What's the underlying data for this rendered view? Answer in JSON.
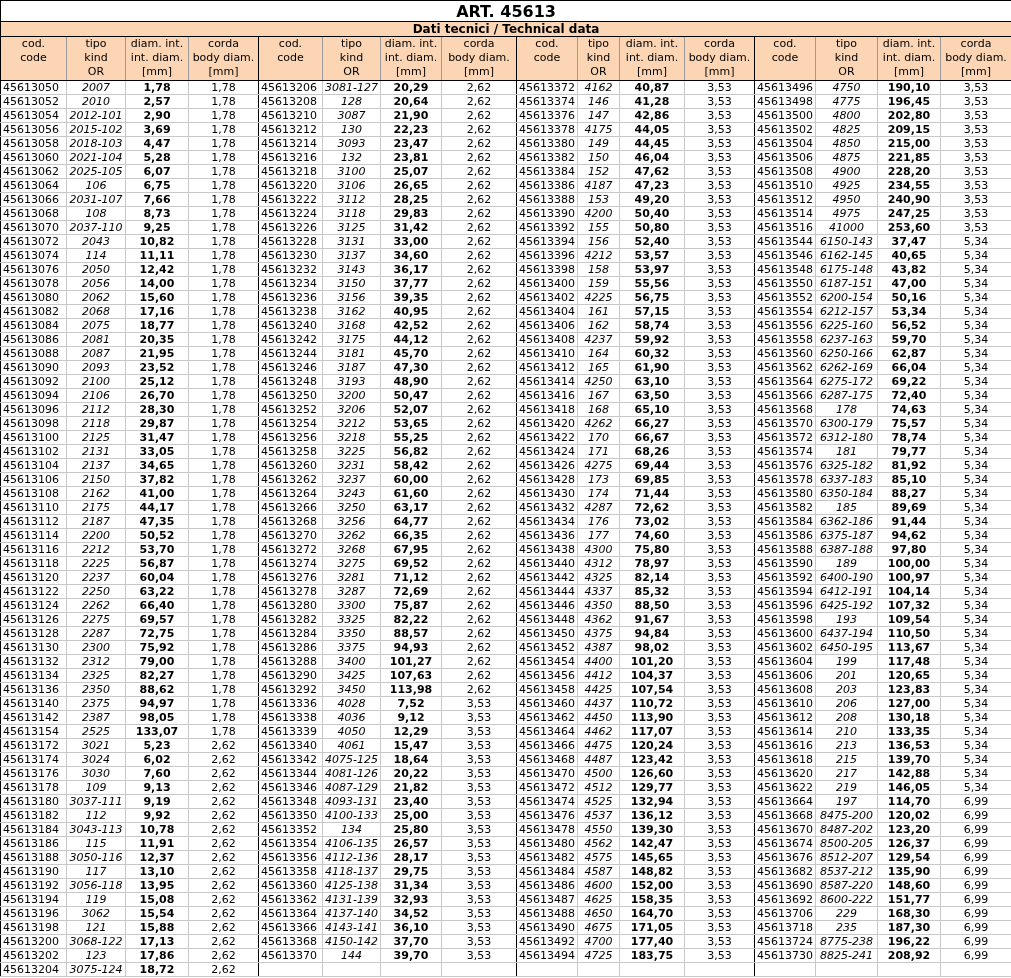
{
  "title": "ART. 45613",
  "subtitle": "Dati tecnici / Technical data",
  "groups": [
    {
      "columns": [
        "cod.\ncode",
        "tipo\nkind\nOR",
        "diam. int.\nint. diam.\n[mm]",
        "corda\nbody diam.\n[mm]"
      ],
      "rows": [
        {
          "code": "45613050",
          "kind": "2007",
          "int_diam": "1,78",
          "body_diam": "1,78"
        },
        {
          "code": "45613052",
          "kind": "2010",
          "int_diam": "2,57",
          "body_diam": "1,78"
        },
        {
          "code": "45613054",
          "kind": "2012-101",
          "int_diam": "2,90",
          "body_diam": "1,78"
        },
        {
          "code": "45613056",
          "kind": "2015-102",
          "int_diam": "3,69",
          "body_diam": "1,78"
        },
        {
          "code": "45613058",
          "kind": "2018-103",
          "int_diam": "4,47",
          "body_diam": "1,78"
        },
        {
          "code": "45613060",
          "kind": "2021-104",
          "int_diam": "5,28",
          "body_diam": "1,78"
        },
        {
          "code": "45613062",
          "kind": "2025-105",
          "int_diam": "6,07",
          "body_diam": "1,78"
        },
        {
          "code": "45613064",
          "kind": "106",
          "int_diam": "6,75",
          "body_diam": "1,78"
        },
        {
          "code": "45613066",
          "kind": "2031-107",
          "int_diam": "7,66",
          "body_diam": "1,78"
        },
        {
          "code": "45613068",
          "kind": "108",
          "int_diam": "8,73",
          "body_diam": "1,78"
        },
        {
          "code": "45613070",
          "kind": "2037-110",
          "int_diam": "9,25",
          "body_diam": "1,78"
        },
        {
          "code": "45613072",
          "kind": "2043",
          "int_diam": "10,82",
          "body_diam": "1,78"
        },
        {
          "code": "45613074",
          "kind": "114",
          "int_diam": "11,11",
          "body_diam": "1,78"
        },
        {
          "code": "45613076",
          "kind": "2050",
          "int_diam": "12,42",
          "body_diam": "1,78"
        },
        {
          "code": "45613078",
          "kind": "2056",
          "int_diam": "14,00",
          "body_diam": "1,78"
        },
        {
          "code": "45613080",
          "kind": "2062",
          "int_diam": "15,60",
          "body_diam": "1,78"
        },
        {
          "code": "45613082",
          "kind": "2068",
          "int_diam": "17,16",
          "body_diam": "1,78"
        },
        {
          "code": "45613084",
          "kind": "2075",
          "int_diam": "18,77",
          "body_diam": "1,78"
        },
        {
          "code": "45613086",
          "kind": "2081",
          "int_diam": "20,35",
          "body_diam": "1,78"
        },
        {
          "code": "45613088",
          "kind": "2087",
          "int_diam": "21,95",
          "body_diam": "1,78"
        },
        {
          "code": "45613090",
          "kind": "2093",
          "int_diam": "23,52",
          "body_diam": "1,78"
        },
        {
          "code": "45613092",
          "kind": "2100",
          "int_diam": "25,12",
          "body_diam": "1,78"
        },
        {
          "code": "45613094",
          "kind": "2106",
          "int_diam": "26,70",
          "body_diam": "1,78"
        },
        {
          "code": "45613096",
          "kind": "2112",
          "int_diam": "28,30",
          "body_diam": "1,78"
        },
        {
          "code": "45613098",
          "kind": "2118",
          "int_diam": "29,87",
          "body_diam": "1,78"
        },
        {
          "code": "45613100",
          "kind": "2125",
          "int_diam": "31,47",
          "body_diam": "1,78"
        },
        {
          "code": "45613102",
          "kind": "2131",
          "int_diam": "33,05",
          "body_diam": "1,78"
        },
        {
          "code": "45613104",
          "kind": "2137",
          "int_diam": "34,65",
          "body_diam": "1,78"
        },
        {
          "code": "45613106",
          "kind": "2150",
          "int_diam": "37,82",
          "body_diam": "1,78"
        },
        {
          "code": "45613108",
          "kind": "2162",
          "int_diam": "41,00",
          "body_diam": "1,78"
        },
        {
          "code": "45613110",
          "kind": "2175",
          "int_diam": "44,17",
          "body_diam": "1,78"
        },
        {
          "code": "45613112",
          "kind": "2187",
          "int_diam": "47,35",
          "body_diam": "1,78"
        },
        {
          "code": "45613114",
          "kind": "2200",
          "int_diam": "50,52",
          "body_diam": "1,78"
        },
        {
          "code": "45613116",
          "kind": "2212",
          "int_diam": "53,70",
          "body_diam": "1,78"
        },
        {
          "code": "45613118",
          "kind": "2225",
          "int_diam": "56,87",
          "body_diam": "1,78"
        },
        {
          "code": "45613120",
          "kind": "2237",
          "int_diam": "60,04",
          "body_diam": "1,78"
        },
        {
          "code": "45613122",
          "kind": "2250",
          "int_diam": "63,22",
          "body_diam": "1,78"
        },
        {
          "code": "45613124",
          "kind": "2262",
          "int_diam": "66,40",
          "body_diam": "1,78"
        },
        {
          "code": "45613126",
          "kind": "2275",
          "int_diam": "69,57",
          "body_diam": "1,78"
        },
        {
          "code": "45613128",
          "kind": "2287",
          "int_diam": "72,75",
          "body_diam": "1,78"
        },
        {
          "code": "45613130",
          "kind": "2300",
          "int_diam": "75,92",
          "body_diam": "1,78"
        },
        {
          "code": "45613132",
          "kind": "2312",
          "int_diam": "79,00",
          "body_diam": "1,78"
        },
        {
          "code": "45613134",
          "kind": "2325",
          "int_diam": "82,27",
          "body_diam": "1,78"
        },
        {
          "code": "45613136",
          "kind": "2350",
          "int_diam": "88,62",
          "body_diam": "1,78"
        },
        {
          "code": "45613140",
          "kind": "2375",
          "int_diam": "94,97",
          "body_diam": "1,78"
        },
        {
          "code": "45613142",
          "kind": "2387",
          "int_diam": "98,05",
          "body_diam": "1,78"
        },
        {
          "code": "45613154",
          "kind": "2525",
          "int_diam": "133,07",
          "body_diam": "1,78"
        },
        {
          "code": "45613172",
          "kind": "3021",
          "int_diam": "5,23",
          "body_diam": "2,62"
        },
        {
          "code": "45613174",
          "kind": "3024",
          "int_diam": "6,02",
          "body_diam": "2,62"
        },
        {
          "code": "45613176",
          "kind": "3030",
          "int_diam": "7,60",
          "body_diam": "2,62"
        },
        {
          "code": "45613178",
          "kind": "109",
          "int_diam": "9,13",
          "body_diam": "2,62"
        },
        {
          "code": "45613180",
          "kind": "3037-111",
          "int_diam": "9,19",
          "body_diam": "2,62"
        },
        {
          "code": "45613182",
          "kind": "112",
          "int_diam": "9,92",
          "body_diam": "2,62"
        },
        {
          "code": "45613184",
          "kind": "3043-113",
          "int_diam": "10,78",
          "body_diam": "2,62"
        },
        {
          "code": "45613186",
          "kind": "115",
          "int_diam": "11,91",
          "body_diam": "2,62"
        },
        {
          "code": "45613188",
          "kind": "3050-116",
          "int_diam": "12,37",
          "body_diam": "2,62"
        },
        {
          "code": "45613190",
          "kind": "117",
          "int_diam": "13,10",
          "body_diam": "2,62"
        },
        {
          "code": "45613192",
          "kind": "3056-118",
          "int_diam": "13,95",
          "body_diam": "2,62"
        },
        {
          "code": "45613194",
          "kind": "119",
          "int_diam": "15,08",
          "body_diam": "2,62"
        },
        {
          "code": "45613196",
          "kind": "3062",
          "int_diam": "15,54",
          "body_diam": "2,62"
        },
        {
          "code": "45613198",
          "kind": "121",
          "int_diam": "15,88",
          "body_diam": "2,62"
        },
        {
          "code": "45613200",
          "kind": "3068-122",
          "int_diam": "17,13",
          "body_diam": "2,62"
        },
        {
          "code": "45613202",
          "kind": "123",
          "int_diam": "17,86",
          "body_diam": "2,62"
        },
        {
          "code": "45613204",
          "kind": "3075-124",
          "int_diam": "18,72",
          "body_diam": "2,62"
        }
      ]
    },
    {
      "columns": [
        "cod.\ncode",
        "tipo\nkind\nOR",
        "diam. int.\nint. diam.\n[mm]",
        "corda\nbody diam.\n[mm]"
      ],
      "rows": [
        {
          "code": "45613206",
          "kind": "3081-127",
          "int_diam": "20,29",
          "body_diam": "2,62"
        },
        {
          "code": "45613208",
          "kind": "128",
          "int_diam": "20,64",
          "body_diam": "2,62"
        },
        {
          "code": "45613210",
          "kind": "3087",
          "int_diam": "21,90",
          "body_diam": "2,62"
        },
        {
          "code": "45613212",
          "kind": "130",
          "int_diam": "22,23",
          "body_diam": "2,62"
        },
        {
          "code": "45613214",
          "kind": "3093",
          "int_diam": "23,47",
          "body_diam": "2,62"
        },
        {
          "code": "45613216",
          "kind": "132",
          "int_diam": "23,81",
          "body_diam": "2,62"
        },
        {
          "code": "45613218",
          "kind": "3100",
          "int_diam": "25,07",
          "body_diam": "2,62"
        },
        {
          "code": "45613220",
          "kind": "3106",
          "int_diam": "26,65",
          "body_diam": "2,62"
        },
        {
          "code": "45613222",
          "kind": "3112",
          "int_diam": "28,25",
          "body_diam": "2,62"
        },
        {
          "code": "45613224",
          "kind": "3118",
          "int_diam": "29,83",
          "body_diam": "2,62"
        },
        {
          "code": "45613226",
          "kind": "3125",
          "int_diam": "31,42",
          "body_diam": "2,62"
        },
        {
          "code": "45613228",
          "kind": "3131",
          "int_diam": "33,00",
          "body_diam": "2,62"
        },
        {
          "code": "45613230",
          "kind": "3137",
          "int_diam": "34,60",
          "body_diam": "2,62"
        },
        {
          "code": "45613232",
          "kind": "3143",
          "int_diam": "36,17",
          "body_diam": "2,62"
        },
        {
          "code": "45613234",
          "kind": "3150",
          "int_diam": "37,77",
          "body_diam": "2,62"
        },
        {
          "code": "45613236",
          "kind": "3156",
          "int_diam": "39,35",
          "body_diam": "2,62"
        },
        {
          "code": "45613238",
          "kind": "3162",
          "int_diam": "40,95",
          "body_diam": "2,62"
        },
        {
          "code": "45613240",
          "kind": "3168",
          "int_diam": "42,52",
          "body_diam": "2,62"
        },
        {
          "code": "45613242",
          "kind": "3175",
          "int_diam": "44,12",
          "body_diam": "2,62"
        },
        {
          "code": "45613244",
          "kind": "3181",
          "int_diam": "45,70",
          "body_diam": "2,62"
        },
        {
          "code": "45613246",
          "kind": "3187",
          "int_diam": "47,30",
          "body_diam": "2,62"
        },
        {
          "code": "45613248",
          "kind": "3193",
          "int_diam": "48,90",
          "body_diam": "2,62"
        },
        {
          "code": "45613250",
          "kind": "3200",
          "int_diam": "50,47",
          "body_diam": "2,62"
        },
        {
          "code": "45613252",
          "kind": "3206",
          "int_diam": "52,07",
          "body_diam": "2,62"
        },
        {
          "code": "45613254",
          "kind": "3212",
          "int_diam": "53,65",
          "body_diam": "2,62"
        },
        {
          "code": "45613256",
          "kind": "3218",
          "int_diam": "55,25",
          "body_diam": "2,62"
        },
        {
          "code": "45613258",
          "kind": "3225",
          "int_diam": "56,82",
          "body_diam": "2,62"
        },
        {
          "code": "45613260",
          "kind": "3231",
          "int_diam": "58,42",
          "body_diam": "2,62"
        },
        {
          "code": "45613262",
          "kind": "3237",
          "int_diam": "60,00",
          "body_diam": "2,62"
        },
        {
          "code": "45613264",
          "kind": "3243",
          "int_diam": "61,60",
          "body_diam": "2,62"
        },
        {
          "code": "45613266",
          "kind": "3250",
          "int_diam": "63,17",
          "body_diam": "2,62"
        },
        {
          "code": "45613268",
          "kind": "3256",
          "int_diam": "64,77",
          "body_diam": "2,62"
        },
        {
          "code": "45613270",
          "kind": "3262",
          "int_diam": "66,35",
          "body_diam": "2,62"
        },
        {
          "code": "45613272",
          "kind": "3268",
          "int_diam": "67,95",
          "body_diam": "2,62"
        },
        {
          "code": "45613274",
          "kind": "3275",
          "int_diam": "69,52",
          "body_diam": "2,62"
        },
        {
          "code": "45613276",
          "kind": "3281",
          "int_diam": "71,12",
          "body_diam": "2,62"
        },
        {
          "code": "45613278",
          "kind": "3287",
          "int_diam": "72,69",
          "body_diam": "2,62"
        },
        {
          "code": "45613280",
          "kind": "3300",
          "int_diam": "75,87",
          "body_diam": "2,62"
        },
        {
          "code": "45613282",
          "kind": "3325",
          "int_diam": "82,22",
          "body_diam": "2,62"
        },
        {
          "code": "45613284",
          "kind": "3350",
          "int_diam": "88,57",
          "body_diam": "2,62"
        },
        {
          "code": "45613286",
          "kind": "3375",
          "int_diam": "94,93",
          "body_diam": "2,62"
        },
        {
          "code": "45613288",
          "kind": "3400",
          "int_diam": "101,27",
          "body_diam": "2,62"
        },
        {
          "code": "45613290",
          "kind": "3425",
          "int_diam": "107,63",
          "body_diam": "2,62"
        },
        {
          "code": "45613292",
          "kind": "3450",
          "int_diam": "113,98",
          "body_diam": "2,62"
        },
        {
          "code": "45613336",
          "kind": "4028",
          "int_diam": "7,52",
          "body_diam": "3,53"
        },
        {
          "code": "45613338",
          "kind": "4036",
          "int_diam": "9,12",
          "body_diam": "3,53"
        },
        {
          "code": "45613339",
          "kind": "4050",
          "int_diam": "12,29",
          "body_diam": "3,53"
        },
        {
          "code": "45613340",
          "kind": "4061",
          "int_diam": "15,47",
          "body_diam": "3,53"
        },
        {
          "code": "45613342",
          "kind": "4075-125",
          "int_diam": "18,64",
          "body_diam": "3,53"
        },
        {
          "code": "45613344",
          "kind": "4081-126",
          "int_diam": "20,22",
          "body_diam": "3,53"
        },
        {
          "code": "45613346",
          "kind": "4087-129",
          "int_diam": "21,82",
          "body_diam": "3,53"
        },
        {
          "code": "45613348",
          "kind": "4093-131",
          "int_diam": "23,40",
          "body_diam": "3,53"
        },
        {
          "code": "45613350",
          "kind": "4100-133",
          "int_diam": "25,00",
          "body_diam": "3,53"
        },
        {
          "code": "45613352",
          "kind": "134",
          "int_diam": "25,80",
          "body_diam": "3,53"
        },
        {
          "code": "45613354",
          "kind": "4106-135",
          "int_diam": "26,57",
          "body_diam": "3,53"
        },
        {
          "code": "45613356",
          "kind": "4112-136",
          "int_diam": "28,17",
          "body_diam": "3,53"
        },
        {
          "code": "45613358",
          "kind": "4118-137",
          "int_diam": "29,75",
          "body_diam": "3,53"
        },
        {
          "code": "45613360",
          "kind": "4125-138",
          "int_diam": "31,34",
          "body_diam": "3,53"
        },
        {
          "code": "45613362",
          "kind": "4131-139",
          "int_diam": "32,93",
          "body_diam": "3,53"
        },
        {
          "code": "45613364",
          "kind": "4137-140",
          "int_diam": "34,52",
          "body_diam": "3,53"
        },
        {
          "code": "45613366",
          "kind": "4143-141",
          "int_diam": "36,10",
          "body_diam": "3,53"
        },
        {
          "code": "45613368",
          "kind": "4150-142",
          "int_diam": "37,70",
          "body_diam": "3,53"
        },
        {
          "code": "45613370",
          "kind": "144",
          "int_diam": "39,70",
          "body_diam": "3,53"
        }
      ]
    },
    {
      "columns": [
        "cod.\ncode",
        "tipo\nkind\nOR",
        "diam. int.\nint. diam.\n[mm]",
        "corda\nbody diam.\n[mm]"
      ],
      "rows": [
        {
          "code": "45613372",
          "kind": "4162",
          "int_diam": "40,87",
          "body_diam": "3,53"
        },
        {
          "code": "45613374",
          "kind": "146",
          "int_diam": "41,28",
          "body_diam": "3,53"
        },
        {
          "code": "45613376",
          "kind": "147",
          "int_diam": "42,86",
          "body_diam": "3,53"
        },
        {
          "code": "45613378",
          "kind": "4175",
          "int_diam": "44,05",
          "body_diam": "3,53"
        },
        {
          "code": "45613380",
          "kind": "149",
          "int_diam": "44,45",
          "body_diam": "3,53"
        },
        {
          "code": "45613382",
          "kind": "150",
          "int_diam": "46,04",
          "body_diam": "3,53"
        },
        {
          "code": "45613384",
          "kind": "152",
          "int_diam": "47,62",
          "body_diam": "3,53"
        },
        {
          "code": "45613386",
          "kind": "4187",
          "int_diam": "47,23",
          "body_diam": "3,53"
        },
        {
          "code": "45613388",
          "kind": "153",
          "int_diam": "49,20",
          "body_diam": "3,53"
        },
        {
          "code": "45613390",
          "kind": "4200",
          "int_diam": "50,40",
          "body_diam": "3,53"
        },
        {
          "code": "45613392",
          "kind": "155",
          "int_diam": "50,80",
          "body_diam": "3,53"
        },
        {
          "code": "45613394",
          "kind": "156",
          "int_diam": "52,40",
          "body_diam": "3,53"
        },
        {
          "code": "45613396",
          "kind": "4212",
          "int_diam": "53,57",
          "body_diam": "3,53"
        },
        {
          "code": "45613398",
          "kind": "158",
          "int_diam": "53,97",
          "body_diam": "3,53"
        },
        {
          "code": "45613400",
          "kind": "159",
          "int_diam": "55,56",
          "body_diam": "3,53"
        },
        {
          "code": "45613402",
          "kind": "4225",
          "int_diam": "56,75",
          "body_diam": "3,53"
        },
        {
          "code": "45613404",
          "kind": "161",
          "int_diam": "57,15",
          "body_diam": "3,53"
        },
        {
          "code": "45613406",
          "kind": "162",
          "int_diam": "58,74",
          "body_diam": "3,53"
        },
        {
          "code": "45613408",
          "kind": "4237",
          "int_diam": "59,92",
          "body_diam": "3,53"
        },
        {
          "code": "45613410",
          "kind": "164",
          "int_diam": "60,32",
          "body_diam": "3,53"
        },
        {
          "code": "45613412",
          "kind": "165",
          "int_diam": "61,90",
          "body_diam": "3,53"
        },
        {
          "code": "45613414",
          "kind": "4250",
          "int_diam": "63,10",
          "body_diam": "3,53"
        },
        {
          "code": "45613416",
          "kind": "167",
          "int_diam": "63,50",
          "body_diam": "3,53"
        },
        {
          "code": "45613418",
          "kind": "168",
          "int_diam": "65,10",
          "body_diam": "3,53"
        },
        {
          "code": "45613420",
          "kind": "4262",
          "int_diam": "66,27",
          "body_diam": "3,53"
        },
        {
          "code": "45613422",
          "kind": "170",
          "int_diam": "66,67",
          "body_diam": "3,53"
        },
        {
          "code": "45613424",
          "kind": "171",
          "int_diam": "68,26",
          "body_diam": "3,53"
        },
        {
          "code": "45613426",
          "kind": "4275",
          "int_diam": "69,44",
          "body_diam": "3,53"
        },
        {
          "code": "45613428",
          "kind": "173",
          "int_diam": "69,85",
          "body_diam": "3,53"
        },
        {
          "code": "45613430",
          "kind": "174",
          "int_diam": "71,44",
          "body_diam": "3,53"
        },
        {
          "code": "45613432",
          "kind": "4287",
          "int_diam": "72,62",
          "body_diam": "3,53"
        },
        {
          "code": "45613434",
          "kind": "176",
          "int_diam": "73,02",
          "body_diam": "3,53"
        },
        {
          "code": "45613436",
          "kind": "177",
          "int_diam": "74,60",
          "body_diam": "3,53"
        },
        {
          "code": "45613438",
          "kind": "4300",
          "int_diam": "75,80",
          "body_diam": "3,53"
        },
        {
          "code": "45613440",
          "kind": "4312",
          "int_diam": "78,97",
          "body_diam": "3,53"
        },
        {
          "code": "45613442",
          "kind": "4325",
          "int_diam": "82,14",
          "body_diam": "3,53"
        },
        {
          "code": "45613444",
          "kind": "4337",
          "int_diam": "85,32",
          "body_diam": "3,53"
        },
        {
          "code": "45613446",
          "kind": "4350",
          "int_diam": "88,50",
          "body_diam": "3,53"
        },
        {
          "code": "45613448",
          "kind": "4362",
          "int_diam": "91,67",
          "body_diam": "3,53"
        },
        {
          "code": "45613450",
          "kind": "4375",
          "int_diam": "94,84",
          "body_diam": "3,53"
        },
        {
          "code": "45613452",
          "kind": "4387",
          "int_diam": "98,02",
          "body_diam": "3,53"
        },
        {
          "code": "45613454",
          "kind": "4400",
          "int_diam": "101,20",
          "body_diam": "3,53"
        },
        {
          "code": "45613456",
          "kind": "4412",
          "int_diam": "104,37",
          "body_diam": "3,53"
        },
        {
          "code": "45613458",
          "kind": "4425",
          "int_diam": "107,54",
          "body_diam": "3,53"
        },
        {
          "code": "45613460",
          "kind": "4437",
          "int_diam": "110,72",
          "body_diam": "3,53"
        },
        {
          "code": "45613462",
          "kind": "4450",
          "int_diam": "113,90",
          "body_diam": "3,53"
        },
        {
          "code": "45613464",
          "kind": "4462",
          "int_diam": "117,07",
          "body_diam": "3,53"
        },
        {
          "code": "45613466",
          "kind": "4475",
          "int_diam": "120,24",
          "body_diam": "3,53"
        },
        {
          "code": "45613468",
          "kind": "4487",
          "int_diam": "123,42",
          "body_diam": "3,53"
        },
        {
          "code": "45613470",
          "kind": "4500",
          "int_diam": "126,60",
          "body_diam": "3,53"
        },
        {
          "code": "45613472",
          "kind": "4512",
          "int_diam": "129,77",
          "body_diam": "3,53"
        },
        {
          "code": "45613474",
          "kind": "4525",
          "int_diam": "132,94",
          "body_diam": "3,53"
        },
        {
          "code": "45613476",
          "kind": "4537",
          "int_diam": "136,12",
          "body_diam": "3,53"
        },
        {
          "code": "45613478",
          "kind": "4550",
          "int_diam": "139,30",
          "body_diam": "3,53"
        },
        {
          "code": "45613480",
          "kind": "4562",
          "int_diam": "142,47",
          "body_diam": "3,53"
        },
        {
          "code": "45613482",
          "kind": "4575",
          "int_diam": "145,65",
          "body_diam": "3,53"
        },
        {
          "code": "45613484",
          "kind": "4587",
          "int_diam": "148,82",
          "body_diam": "3,53"
        },
        {
          "code": "45613486",
          "kind": "4600",
          "int_diam": "152,00",
          "body_diam": "3,53"
        },
        {
          "code": "45613487",
          "kind": "4625",
          "int_diam": "158,35",
          "body_diam": "3,53"
        },
        {
          "code": "45613488",
          "kind": "4650",
          "int_diam": "164,70",
          "body_diam": "3,53"
        },
        {
          "code": "45613490",
          "kind": "4675",
          "int_diam": "171,05",
          "body_diam": "3,53"
        },
        {
          "code": "45613492",
          "kind": "4700",
          "int_diam": "177,40",
          "body_diam": "3,53"
        },
        {
          "code": "45613494",
          "kind": "4725",
          "int_diam": "183,75",
          "body_diam": "3,53"
        }
      ]
    },
    {
      "columns": [
        "cod.\ncode",
        "tipo\nkind\nOR",
        "diam. int.\nint. diam.\n[mm]",
        "corda\nbody diam.\n[mm]"
      ],
      "rows": [
        {
          "code": "45613496",
          "kind": "4750",
          "int_diam": "190,10",
          "body_diam": "3,53"
        },
        {
          "code": "45613498",
          "kind": "4775",
          "int_diam": "196,45",
          "body_diam": "3,53"
        },
        {
          "code": "45613500",
          "kind": "4800",
          "int_diam": "202,80",
          "body_diam": "3,53"
        },
        {
          "code": "45613502",
          "kind": "4825",
          "int_diam": "209,15",
          "body_diam": "3,53"
        },
        {
          "code": "45613504",
          "kind": "4850",
          "int_diam": "215,00",
          "body_diam": "3,53"
        },
        {
          "code": "45613506",
          "kind": "4875",
          "int_diam": "221,85",
          "body_diam": "3,53"
        },
        {
          "code": "45613508",
          "kind": "4900",
          "int_diam": "228,20",
          "body_diam": "3,53"
        },
        {
          "code": "45613510",
          "kind": "4925",
          "int_diam": "234,55",
          "body_diam": "3,53"
        },
        {
          "code": "45613512",
          "kind": "4950",
          "int_diam": "240,90",
          "body_diam": "3,53"
        },
        {
          "code": "45613514",
          "kind": "4975",
          "int_diam": "247,25",
          "body_diam": "3,53"
        },
        {
          "code": "45613516",
          "kind": "41000",
          "int_diam": "253,60",
          "body_diam": "3,53"
        },
        {
          "code": "45613544",
          "kind": "6150-143",
          "int_diam": "37,47",
          "body_diam": "5,34"
        },
        {
          "code": "45613546",
          "kind": "6162-145",
          "int_diam": "40,65",
          "body_diam": "5,34"
        },
        {
          "code": "45613548",
          "kind": "6175-148",
          "int_diam": "43,82",
          "body_diam": "5,34"
        },
        {
          "code": "45613550",
          "kind": "6187-151",
          "int_diam": "47,00",
          "body_diam": "5,34"
        },
        {
          "code": "45613552",
          "kind": "6200-154",
          "int_diam": "50,16",
          "body_diam": "5,34"
        },
        {
          "code": "45613554",
          "kind": "6212-157",
          "int_diam": "53,34",
          "body_diam": "5,34"
        },
        {
          "code": "45613556",
          "kind": "6225-160",
          "int_diam": "56,52",
          "body_diam": "5,34"
        },
        {
          "code": "45613558",
          "kind": "6237-163",
          "int_diam": "59,70",
          "body_diam": "5,34"
        },
        {
          "code": "45613560",
          "kind": "6250-166",
          "int_diam": "62,87",
          "body_diam": "5,34"
        },
        {
          "code": "45613562",
          "kind": "6262-169",
          "int_diam": "66,04",
          "body_diam": "5,34"
        },
        {
          "code": "45613564",
          "kind": "6275-172",
          "int_diam": "69,22",
          "body_diam": "5,34"
        },
        {
          "code": "45613566",
          "kind": "6287-175",
          "int_diam": "72,40",
          "body_diam": "5,34"
        },
        {
          "code": "45613568",
          "kind": "178",
          "int_diam": "74,63",
          "body_diam": "5,34"
        },
        {
          "code": "45613570",
          "kind": "6300-179",
          "int_diam": "75,57",
          "body_diam": "5,34"
        },
        {
          "code": "45613572",
          "kind": "6312-180",
          "int_diam": "78,74",
          "body_diam": "5,34"
        },
        {
          "code": "45613574",
          "kind": "181",
          "int_diam": "79,77",
          "body_diam": "5,34"
        },
        {
          "code": "45613576",
          "kind": "6325-182",
          "int_diam": "81,92",
          "body_diam": "5,34"
        },
        {
          "code": "45613578",
          "kind": "6337-183",
          "int_diam": "85,10",
          "body_diam": "5,34"
        },
        {
          "code": "45613580",
          "kind": "6350-184",
          "int_diam": "88,27",
          "body_diam": "5,34"
        },
        {
          "code": "45613582",
          "kind": "185",
          "int_diam": "89,69",
          "body_diam": "5,34"
        },
        {
          "code": "45613584",
          "kind": "6362-186",
          "int_diam": "91,44",
          "body_diam": "5,34"
        },
        {
          "code": "45613586",
          "kind": "6375-187",
          "int_diam": "94,62",
          "body_diam": "5,34"
        },
        {
          "code": "45613588",
          "kind": "6387-188",
          "int_diam": "97,80",
          "body_diam": "5,34"
        },
        {
          "code": "45613590",
          "kind": "189",
          "int_diam": "100,00",
          "body_diam": "5,34"
        },
        {
          "code": "45613592",
          "kind": "6400-190",
          "int_diam": "100,97",
          "body_diam": "5,34"
        },
        {
          "code": "45613594",
          "kind": "6412-191",
          "int_diam": "104,14",
          "body_diam": "5,34"
        },
        {
          "code": "45613596",
          "kind": "6425-192",
          "int_diam": "107,32",
          "body_diam": "5,34"
        },
        {
          "code": "45613598",
          "kind": "193",
          "int_diam": "109,54",
          "body_diam": "5,34"
        },
        {
          "code": "45613600",
          "kind": "6437-194",
          "int_diam": "110,50",
          "body_diam": "5,34"
        },
        {
          "code": "45613602",
          "kind": "6450-195",
          "int_diam": "113,67",
          "body_diam": "5,34"
        },
        {
          "code": "45613604",
          "kind": "199",
          "int_diam": "117,48",
          "body_diam": "5,34"
        },
        {
          "code": "45613606",
          "kind": "201",
          "int_diam": "120,65",
          "body_diam": "5,34"
        },
        {
          "code": "45613608",
          "kind": "203",
          "int_diam": "123,83",
          "body_diam": "5,34"
        },
        {
          "code": "45613610",
          "kind": "206",
          "int_diam": "127,00",
          "body_diam": "5,34"
        },
        {
          "code": "45613612",
          "kind": "208",
          "int_diam": "130,18",
          "body_diam": "5,34"
        },
        {
          "code": "45613614",
          "kind": "210",
          "int_diam": "133,35",
          "body_diam": "5,34"
        },
        {
          "code": "45613616",
          "kind": "213",
          "int_diam": "136,53",
          "body_diam": "5,34"
        },
        {
          "code": "45613618",
          "kind": "215",
          "int_diam": "139,70",
          "body_diam": "5,34"
        },
        {
          "code": "45613620",
          "kind": "217",
          "int_diam": "142,88",
          "body_diam": "5,34"
        },
        {
          "code": "45613622",
          "kind": "219",
          "int_diam": "146,05",
          "body_diam": "5,34"
        },
        {
          "code": "45613664",
          "kind": "197",
          "int_diam": "114,70",
          "body_diam": "6,99"
        },
        {
          "code": "45613668",
          "kind": "8475-200",
          "int_diam": "120,02",
          "body_diam": "6,99"
        },
        {
          "code": "45613670",
          "kind": "8487-202",
          "int_diam": "123,20",
          "body_diam": "6,99"
        },
        {
          "code": "45613674",
          "kind": "8500-205",
          "int_diam": "126,37",
          "body_diam": "6,99"
        },
        {
          "code": "45613676",
          "kind": "8512-207",
          "int_diam": "129,54",
          "body_diam": "6,99"
        },
        {
          "code": "45613682",
          "kind": "8537-212",
          "int_diam": "135,90",
          "body_diam": "6,99"
        },
        {
          "code": "45613690",
          "kind": "8587-220",
          "int_diam": "148,60",
          "body_diam": "6,99"
        },
        {
          "code": "45613692",
          "kind": "8600-222",
          "int_diam": "151,77",
          "body_diam": "6,99"
        },
        {
          "code": "45613706",
          "kind": "229",
          "int_diam": "168,30",
          "body_diam": "6,99"
        },
        {
          "code": "45613718",
          "kind": "235",
          "int_diam": "187,30",
          "body_diam": "6,99"
        },
        {
          "code": "45613724",
          "kind": "8775-238",
          "int_diam": "196,22",
          "body_diam": "6,99"
        },
        {
          "code": "45613730",
          "kind": "8825-241",
          "int_diam": "208,92",
          "body_diam": "6,99"
        }
      ]
    }
  ]
}
